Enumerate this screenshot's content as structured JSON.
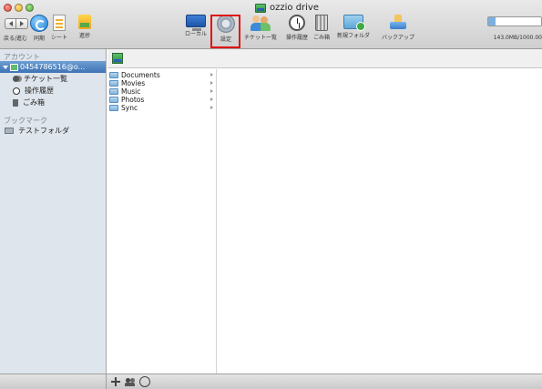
{
  "window": {
    "title": "ozzio drive"
  },
  "toolbar": {
    "back_forward_label": "戻る/進む",
    "items": [
      {
        "id": "sync",
        "label": "同期"
      },
      {
        "id": "sheet",
        "label": "シート"
      },
      {
        "id": "progress",
        "label": "進捗"
      },
      {
        "id": "local",
        "label": "ローカル"
      },
      {
        "id": "settings",
        "label": "設定"
      },
      {
        "id": "ticket-list",
        "label": "チケット一覧"
      },
      {
        "id": "history",
        "label": "操作履歴"
      },
      {
        "id": "trash",
        "label": "ごみ箱"
      },
      {
        "id": "new-folder",
        "label": "新規フォルダ"
      },
      {
        "id": "backup",
        "label": "バックアップ"
      }
    ],
    "capacity": {
      "used_fraction": 0.143,
      "label": "143.0MB/1000.00"
    }
  },
  "sidebar": {
    "account_heading": "アカウント",
    "account_name": "0454786516@o...",
    "account_items": [
      {
        "label": "チケット一覧",
        "icon": "ticket-icon"
      },
      {
        "label": "操作履歴",
        "icon": "clock-icon"
      },
      {
        "label": "ごみ箱",
        "icon": "trash-icon"
      }
    ],
    "bookmark_heading": "ブックマーク",
    "bookmarks": [
      {
        "label": "テストフォルダ",
        "icon": "folder-icon"
      }
    ]
  },
  "browser": {
    "folders": [
      "Documents",
      "Movies",
      "Music",
      "Photos",
      "Sync"
    ]
  }
}
